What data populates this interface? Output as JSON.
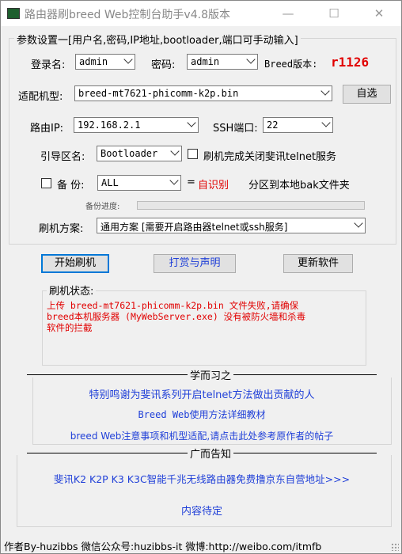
{
  "window": {
    "title": "路由器刷breed Web控制台助手v4.8版本",
    "minimize": "—",
    "maximize": "☐",
    "close": "✕"
  },
  "params": {
    "legend": "参数设置一[用户名,密码,IP地址,bootloader,端口可手动输入]",
    "username_label": "登录名:",
    "username_value": "admin",
    "password_label": "密码:",
    "password_value": "admin",
    "breed_version_label": "Breed版本:",
    "breed_version_value": "r1126",
    "model_label": "适配机型:",
    "model_value": "breed-mt7621-phicomm-k2p.bin",
    "auto_button": "自选",
    "router_ip_label": "路由IP:",
    "router_ip_value": "192.168.2.1",
    "ssh_port_label": "SSH端口:",
    "ssh_port_value": "22",
    "boot_partition_label": "引导区名:",
    "boot_partition_value": "Bootloader",
    "close_telnet_label": "刷机完成关闭斐讯telnet服务",
    "close_telnet_checked": false,
    "backup_label": "备 份:",
    "backup_checked": false,
    "backup_value": "ALL",
    "auto_detect_eq": "=",
    "auto_detect_label": "自识别",
    "backup_desc": "分区到本地bak文件夹",
    "backup_progress_label": "备份进度:",
    "backup_progress": 0,
    "flash_scheme_label": "刷机方案:",
    "flash_scheme_value": "通用方案 [需要开启路由器telnet或ssh服务]"
  },
  "actions": {
    "start_flash": "开始刷机",
    "donate": "打赏与声明",
    "update": "更新软件"
  },
  "status": {
    "title": "刷机状态:",
    "lines": [
      "上传 breed-mt7621-phicomm-k2p.bin 文件失败,请确保",
      "breed本机服务器 (MyWebServer.exe) 没有被防火墙和杀毒",
      "软件的拦截"
    ]
  },
  "learn": {
    "title": "学而习之",
    "links": [
      "特别鸣谢为斐讯系列开启telnet方法做出贡献的人",
      "Breed Web使用方法详细教材",
      "breed Web注意事项和机型适配,请点击此处参考原作者的帖子"
    ]
  },
  "ads": {
    "title": "广而告知",
    "links": [
      "斐讯K2 K2P K3 K3C智能千兆无线路由器免费撸京东自营地址>>>",
      "内容待定"
    ]
  },
  "footer": {
    "text": "作者By-huzibbs 微信公众号:huzibbs-it 微博:http://weibo.com/itmfb"
  },
  "colors": {
    "accent_blue": "#1f3fd8",
    "error_red": "#e10000",
    "progress_green": "#06b025"
  }
}
